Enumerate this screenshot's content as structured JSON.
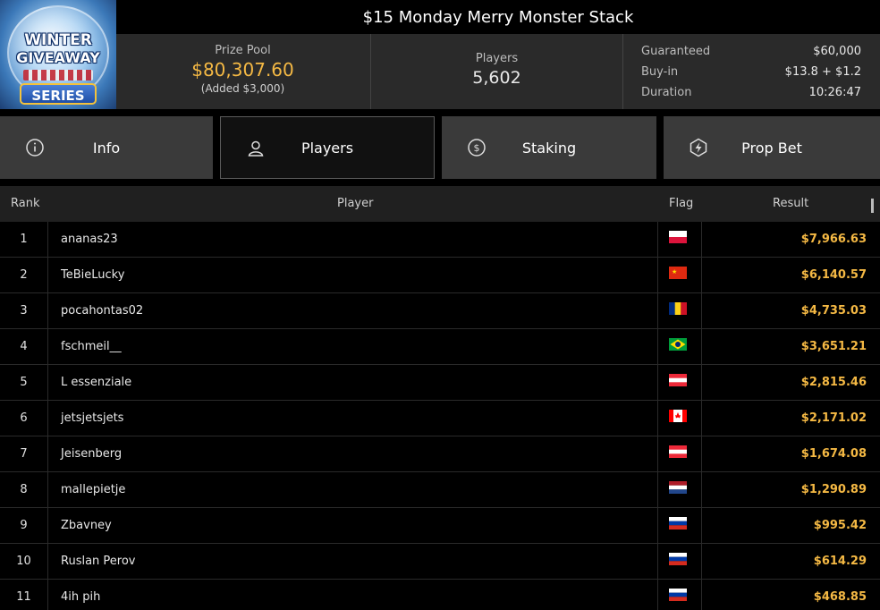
{
  "banner": {
    "line1": "WINTER",
    "line2": "GIVEAWAY",
    "line3": "SERIES"
  },
  "tournament": {
    "title": "$15 Monday Merry Monster Stack",
    "prize_pool_label": "Prize Pool",
    "prize_pool_value": "$80,307.60",
    "prize_pool_added": "(Added $3,000)",
    "players_label": "Players",
    "players_value": "5,602",
    "guaranteed_label": "Guaranteed",
    "guaranteed_value": "$60,000",
    "buyin_label": "Buy-in",
    "buyin_value": "$13.8 + $1.2",
    "duration_label": "Duration",
    "duration_value": "10:26:47"
  },
  "tabs": [
    {
      "label": "Info",
      "icon": "info-icon",
      "active": false
    },
    {
      "label": "Players",
      "icon": "user-icon",
      "active": true
    },
    {
      "label": "Staking",
      "icon": "dollar-coin-icon",
      "active": false
    },
    {
      "label": "Prop Bet",
      "icon": "lightning-icon",
      "active": false
    }
  ],
  "table": {
    "headers": {
      "rank": "Rank",
      "player": "Player",
      "flag": "Flag",
      "result": "Result"
    },
    "rows": [
      {
        "rank": "1",
        "player": "ananas23",
        "flag": "poland",
        "result": "$7,966.63"
      },
      {
        "rank": "2",
        "player": "TeBieLucky",
        "flag": "china",
        "result": "$6,140.57"
      },
      {
        "rank": "3",
        "player": "pocahontas02",
        "flag": "romania",
        "result": "$4,735.03"
      },
      {
        "rank": "4",
        "player": "fschmeil__",
        "flag": "brazil",
        "result": "$3,651.21"
      },
      {
        "rank": "5",
        "player": "L essenziale",
        "flag": "austria",
        "result": "$2,815.46"
      },
      {
        "rank": "6",
        "player": "jetsjetsjets",
        "flag": "canada",
        "result": "$2,171.02"
      },
      {
        "rank": "7",
        "player": "Jeisenberg",
        "flag": "austria",
        "result": "$1,674.08"
      },
      {
        "rank": "8",
        "player": "mallepietje",
        "flag": "netherlands",
        "result": "$1,290.89"
      },
      {
        "rank": "9",
        "player": "Zbavney",
        "flag": "russia",
        "result": "$995.42"
      },
      {
        "rank": "10",
        "player": "Ruslan Perov",
        "flag": "russia",
        "result": "$614.29"
      },
      {
        "rank": "11",
        "player": "4ih pih",
        "flag": "russia",
        "result": "$468.85"
      }
    ]
  },
  "colors": {
    "accent": "#f5b944",
    "header_bg": "#2a2a2a",
    "tab_bg": "#3a3a3a",
    "active_tab_bg": "#111111"
  }
}
